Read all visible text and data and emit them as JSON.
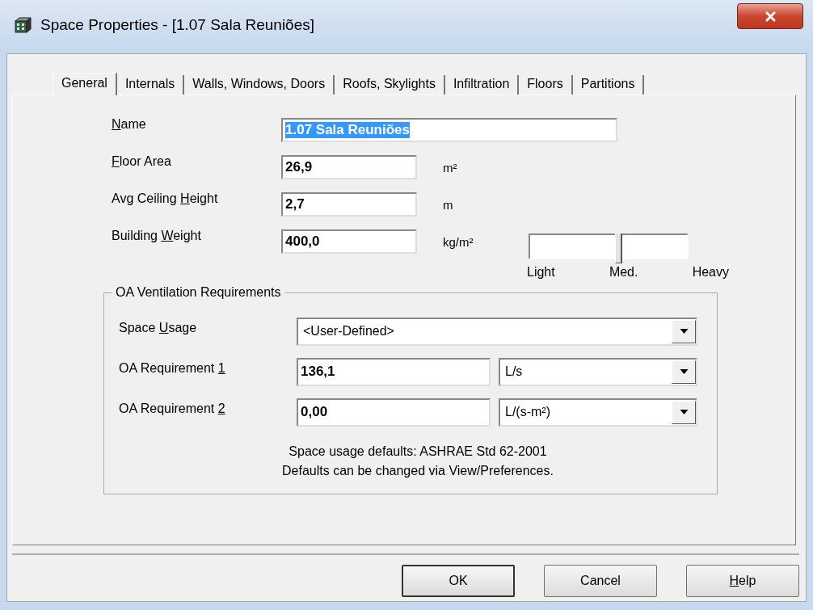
{
  "window": {
    "title": "Space Properties - [1.07 Sala Reuniões]"
  },
  "tabs": [
    {
      "label": "General",
      "selected": true
    },
    {
      "label": "Internals",
      "selected": false
    },
    {
      "label": "Walls, Windows, Doors",
      "selected": false
    },
    {
      "label": "Roofs, Skylights",
      "selected": false
    },
    {
      "label": "Infiltration",
      "selected": false
    },
    {
      "label": "Floors",
      "selected": false
    },
    {
      "label": "Partitions",
      "selected": false
    }
  ],
  "fields": [
    {
      "label_key": "N",
      "label_after": "ame",
      "value": "1.07 Sala Reuniões",
      "text_selected": true
    },
    {
      "label_key": "F",
      "label_after": "loor Area",
      "value": "26,9",
      "unit": "m²",
      "text_selected": false
    },
    {
      "label_before": "Avg Ceiling ",
      "label_key": "H",
      "label_after": "eight",
      "value": "2,7",
      "unit": "m",
      "text_selected": false
    },
    {
      "label_before": "Building ",
      "label_key": "W",
      "label_after": "eight",
      "value": "400,0",
      "unit": "kg/m²",
      "text_selected": false
    }
  ],
  "weight_slider": {
    "level": 0.56,
    "labels": [
      "Light",
      "Med.",
      "Heavy"
    ]
  },
  "ventilation": {
    "title": "OA Ventilation Requirements",
    "rows": [
      {
        "label_before": "Space ",
        "label_key": "U",
        "label_after": "sage",
        "choice": "<User-Defined>"
      },
      {
        "label_before": "OA Requirement ",
        "label_key": "1",
        "value": "136,1",
        "choice": "L/s"
      },
      {
        "label_before": "OA Requirement ",
        "label_key": "2",
        "value": "0,00",
        "choice": "L/(s-m²)"
      }
    ],
    "notes": [
      "Space usage defaults: ASHRAE Std 62-2001",
      "Defaults can be changed via View/Preferences."
    ]
  },
  "buttons": [
    {
      "label": "OK",
      "kind": "default"
    },
    {
      "label": "Cancel",
      "kind": "plain"
    },
    {
      "label_key": "H",
      "label_after": "elp",
      "kind": "plain"
    }
  ]
}
